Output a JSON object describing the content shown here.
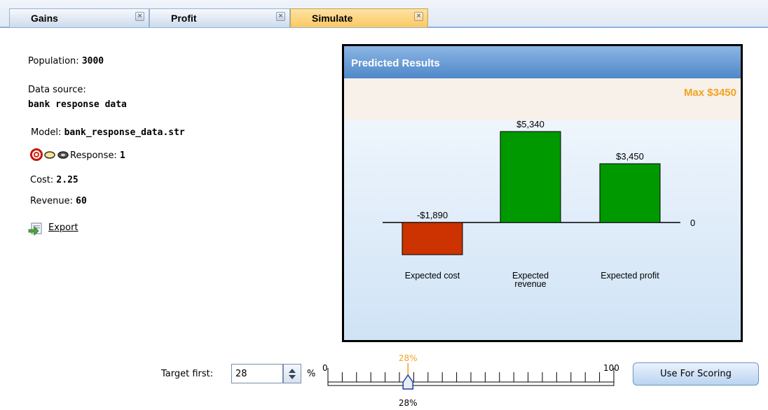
{
  "tabs": [
    {
      "label": "Gains",
      "active": false
    },
    {
      "label": "Profit",
      "active": false
    },
    {
      "label": "Simulate",
      "active": true
    }
  ],
  "info": {
    "population_label": "Population:",
    "population_value": "3000",
    "data_source_label": "Data source:",
    "data_source_value": "bank response data",
    "model_label": "Model:",
    "model_value": "bank_response_data.str",
    "response_label": "Response:",
    "response_value": "1",
    "cost_label": "Cost:",
    "cost_value": "2.25",
    "revenue_label": "Revenue:",
    "revenue_value": "60",
    "export_label": "Export"
  },
  "panel": {
    "title": "Predicted Results",
    "max_label": "Max $3450"
  },
  "chart_data": {
    "type": "bar",
    "categories": [
      "Expected cost",
      "Expected revenue",
      "Expected profit"
    ],
    "category_lines": [
      [
        "Expected cost"
      ],
      [
        "Expected",
        "revenue"
      ],
      [
        "Expected profit"
      ]
    ],
    "values": [
      -1890,
      5340,
      3450
    ],
    "value_labels": [
      "-$1,890",
      "$5,340",
      "$3,450"
    ],
    "colors": [
      "#cc3300",
      "#009900",
      "#009900"
    ],
    "zero_label": "0"
  },
  "target": {
    "label": "Target first:",
    "value": "28",
    "unit": "%"
  },
  "slider": {
    "min_label": "0",
    "max_label": "100",
    "value": 28,
    "value_top_label": "28%",
    "value_bottom_label": "28%",
    "accent": "#f3a21f",
    "thumb_color": "#1f3f9f"
  },
  "buttons": {
    "use_for_scoring": "Use For Scoring"
  }
}
